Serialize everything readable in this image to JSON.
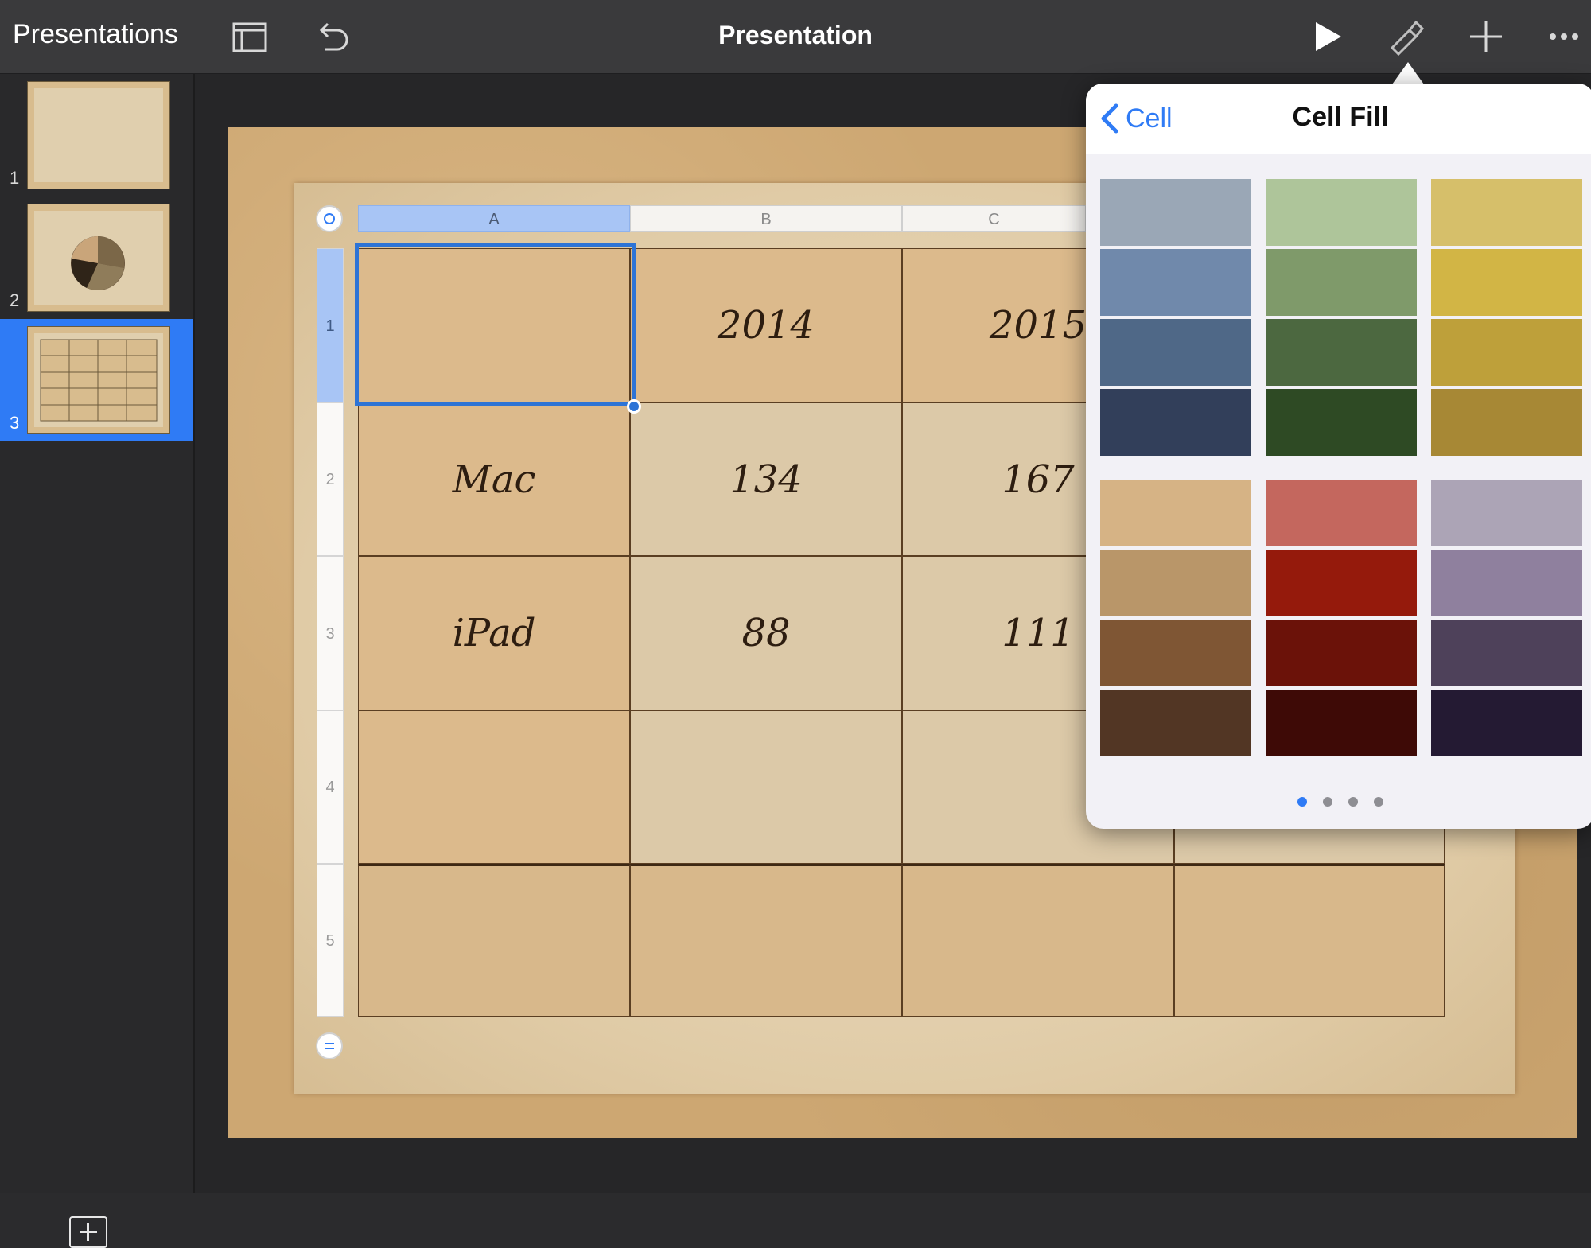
{
  "toolbar": {
    "back_label": "Presentations",
    "title": "Presentation",
    "icons": [
      "layout-icon",
      "undo-icon",
      "play-icon",
      "format-brush-icon",
      "add-icon",
      "more-icon"
    ]
  },
  "slides": [
    {
      "number": "1"
    },
    {
      "number": "2"
    },
    {
      "number": "3",
      "selected": true
    }
  ],
  "table": {
    "columns": [
      "A",
      "B",
      "C"
    ],
    "rows": [
      "1",
      "2",
      "3",
      "4",
      "5"
    ],
    "cells": [
      [
        "",
        "2014",
        "2015",
        ""
      ],
      [
        "Mac",
        "134",
        "167",
        ""
      ],
      [
        "iPad",
        "88",
        "111",
        ""
      ],
      [
        "",
        "",
        "",
        ""
      ],
      [
        "",
        "",
        "",
        ""
      ]
    ]
  },
  "popover": {
    "back_label": "Cell",
    "title": "Cell Fill",
    "swatch_groups": [
      [
        "#9aa7b6",
        "#7089ab",
        "#4f6887",
        "#323f5a"
      ],
      [
        "#aec59a",
        "#7f9a6a",
        "#4c6840",
        "#2e4a24"
      ],
      [
        "#d6bf6a",
        "#d2b545",
        "#bea03a",
        "#a78835"
      ],
      [
        "#d6b385",
        "#b99669",
        "#7f5634",
        "#523624"
      ],
      [
        "#c4675e",
        "#951a0c",
        "#6b1209",
        "#3e0a06"
      ],
      [
        "#aca4b6",
        "#8f809e",
        "#4e415a",
        "#241a33"
      ]
    ],
    "pages": 4,
    "active_page": 1
  },
  "colors": {
    "accent": "#2f7bf5",
    "toolbar_bg": "#3a3a3c",
    "sidebar_bg": "#29292b"
  }
}
